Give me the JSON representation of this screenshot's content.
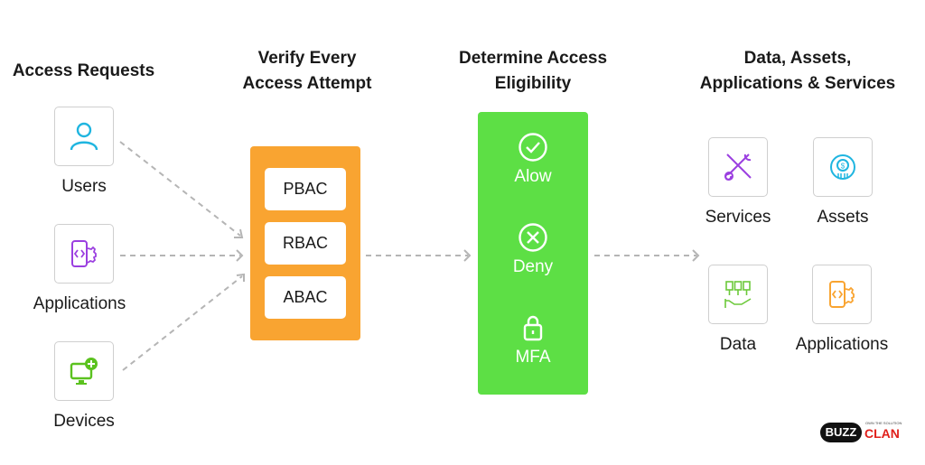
{
  "headings": {
    "requests": "Access Requests",
    "verify_1": "Verify Every",
    "verify_2": "Access Attempt",
    "determine_1": "Determine Access",
    "determine_2": "Eligibility",
    "resources_1": "Data, Assets,",
    "resources_2": "Applications & Services"
  },
  "requests": [
    {
      "label": "Users",
      "icon": "user-icon",
      "color": "#1fb5e0"
    },
    {
      "label": "Applications",
      "icon": "app-gear-icon",
      "color": "#9b3fe0"
    },
    {
      "label": "Devices",
      "icon": "monitor-plus-icon",
      "color": "#5bc21f"
    }
  ],
  "verify": {
    "items": [
      "PBAC",
      "RBAC",
      "ABAC"
    ],
    "color": "#f9a431"
  },
  "determine": {
    "items": [
      {
        "label": "Alow",
        "icon": "check-circle-icon"
      },
      {
        "label": "Deny",
        "icon": "x-circle-icon"
      },
      {
        "label": "MFA",
        "icon": "lock-icon"
      }
    ],
    "color": "#5ddf45"
  },
  "resources": [
    {
      "label": "Services",
      "icon": "tools-icon",
      "color": "#9b3fe0"
    },
    {
      "label": "Assets",
      "icon": "asset-chart-icon",
      "color": "#1fb5e0"
    },
    {
      "label": "Data",
      "icon": "data-hand-icon",
      "color": "#6cc93a"
    },
    {
      "label": "Applications",
      "icon": "app-gear-icon",
      "color": "#f9a431"
    }
  ],
  "logo": {
    "text_1": "BUZZ",
    "text_2": "CLAN",
    "tagline": "Own the Solution"
  }
}
